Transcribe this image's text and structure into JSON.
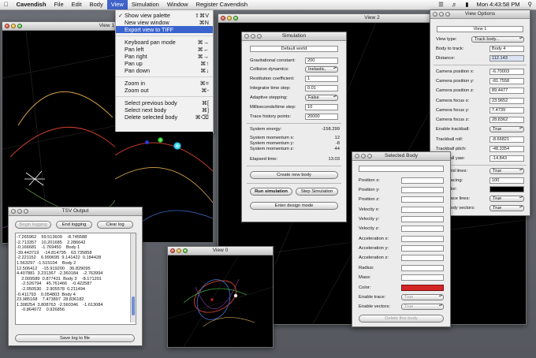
{
  "menubar": {
    "app": "Cavendish",
    "items": [
      "File",
      "Edit",
      "Body",
      "View",
      "Simulation",
      "Window",
      "Register Cavendish"
    ],
    "active": "View",
    "clock": "Mon 4:43:58 PM"
  },
  "view_menu": {
    "items": [
      {
        "label": "Show view palette",
        "shortcut": "⇧⌘V",
        "checked": true
      },
      {
        "label": "New view window",
        "shortcut": "⌘N"
      },
      {
        "label": "Export view to TIFF",
        "shortcut": "",
        "highlighted": true
      },
      {
        "label": "Keyboard pan mode",
        "shortcut": "⌘→"
      },
      {
        "label": "Pan left",
        "shortcut": "⌘←"
      },
      {
        "label": "Pan right",
        "shortcut": "⌘→"
      },
      {
        "label": "Pan up",
        "shortcut": "⌘↑"
      },
      {
        "label": "Pan down",
        "shortcut": "⌘↓"
      },
      {
        "label": "Zoom in",
        "shortcut": "⌘="
      },
      {
        "label": "Zoom out",
        "shortcut": "⌘-"
      },
      {
        "label": "Select previous body",
        "shortcut": "⌘["
      },
      {
        "label": "Select next body",
        "shortcut": "⌘]"
      },
      {
        "label": "Delete selected body",
        "shortcut": "⌘⌫"
      }
    ]
  },
  "view1_window": {
    "title": "View 1"
  },
  "view2_window": {
    "title": "View 2"
  },
  "view0_window": {
    "title": "View 0"
  },
  "simulation": {
    "title": "Simulation",
    "world_button": "Default world",
    "fields": [
      {
        "label": "Gravitational constant:",
        "value": "200",
        "kind": "field"
      },
      {
        "label": "Collision dynamics:",
        "value": "Inelastic,",
        "kind": "popup"
      },
      {
        "label": "Restitution coefficient:",
        "value": "1",
        "kind": "field"
      },
      {
        "label": "Integrator time step:",
        "value": "0.01",
        "kind": "field"
      },
      {
        "label": "Adaptive stepping:",
        "value": "False",
        "kind": "popup"
      },
      {
        "label": "Milliseconds/time step:",
        "value": "10",
        "kind": "field"
      },
      {
        "label": "Trace history points:",
        "value": "20000",
        "kind": "field"
      }
    ],
    "stats": [
      {
        "label": "System energy:",
        "value": "-158.299"
      },
      {
        "label": "System momentum x:",
        "value": "12"
      },
      {
        "label": "System momentum y:",
        "value": "-8"
      },
      {
        "label": "System momentum z:",
        "value": "44"
      },
      {
        "label": "Elapsed time:",
        "value": "13.03"
      }
    ],
    "create_body": "Create new body",
    "run": "Run simulation",
    "step": "Step Simulation",
    "design": "Enter design mode"
  },
  "view_options": {
    "title": "View Options",
    "view_button": "View 1",
    "fields": [
      {
        "label": "View type:",
        "value": "Track body...",
        "kind": "popup"
      },
      {
        "label": "Body to track:",
        "value": "Body 4",
        "kind": "field"
      },
      {
        "label": "Distance:",
        "value": "112.143",
        "kind": "field"
      },
      {
        "label": "Camera position x:",
        "value": "-6.70003",
        "kind": "field"
      },
      {
        "label": "Camera position y:",
        "value": "-81.7558",
        "kind": "field"
      },
      {
        "label": "Camera position z:",
        "value": "89.4477",
        "kind": "field"
      },
      {
        "label": "Camera focus x:",
        "value": "23.9652",
        "kind": "field"
      },
      {
        "label": "Camera focus y:",
        "value": "7.4739",
        "kind": "field"
      },
      {
        "label": "Camera focus z:",
        "value": "28.8362",
        "kind": "field"
      },
      {
        "label": "Enable trackball:",
        "value": "True",
        "kind": "popup"
      },
      {
        "label": "Trackball roll:",
        "value": "-8.66821",
        "kind": "field"
      },
      {
        "label": "Trackball pitch:",
        "value": "-48.3354",
        "kind": "field"
      },
      {
        "label": "Trackball yaw:",
        "value": "-14.843",
        "kind": "field"
      },
      {
        "label": "Draw grid lines:",
        "value": "True",
        "kind": "popup"
      },
      {
        "label": "Grid spacing:",
        "value": "100",
        "kind": "field"
      },
      {
        "label": "Grid color:",
        "value": "",
        "kind": "swatch"
      },
      {
        "label": "Draw trace lines:",
        "value": "True",
        "kind": "popup"
      },
      {
        "label": "Draw body vectors:",
        "value": "True",
        "kind": "popup"
      }
    ]
  },
  "selected_body": {
    "title": "Selected Body",
    "fields": [
      {
        "label": "Position x:"
      },
      {
        "label": "Position y:"
      },
      {
        "label": "Position z:"
      },
      {
        "label": "Velocity x:"
      },
      {
        "label": "Velocity y:"
      },
      {
        "label": "Velocity z:"
      },
      {
        "label": "Acceleration x:"
      },
      {
        "label": "Acceleration y:"
      },
      {
        "label": "Acceleration z:"
      },
      {
        "label": "Radius:"
      },
      {
        "label": "Mass:"
      },
      {
        "label": "Color:"
      },
      {
        "label": "Enable trace:",
        "value": "True"
      },
      {
        "label": "Enable vectors:",
        "value": "True"
      }
    ],
    "delete": "Delete this body"
  },
  "tsv_output": {
    "title": "TSV Output",
    "begin": "Begin logging",
    "end": "End logging",
    "clear": "Clear log",
    "save": "Save log to file",
    "log": "-7.265962    59.513609    -8.745588\n-2.713357    10.201685    2.286642\n-0.166681    -1.769450    Body 1\n-39.443719    -14.814795    63.735858\n-2.221152    6.999695  9.141422  0.184428\n1.563297  -1.515104    Body 2\n12.506412    -15.919200    36.829095\n4.407881  3.231367  -2.360184    -2.763994\n    2.009589  0.877431  Body 3    -8.171201\n    -2.526794    45.761466    -0.422587\n    -2.050530    2.905578  0.211494\n-0.411793    0.054803  Body 4\n23.985168    7.473897  28.836182\n1.308254  3.808763  -2.560346    -1.613084\n    -0.864072    0.926856"
  },
  "colors": {
    "menu_highlight": "#3a63cd",
    "body_color": "#d42525",
    "grid_color": "#000000"
  }
}
